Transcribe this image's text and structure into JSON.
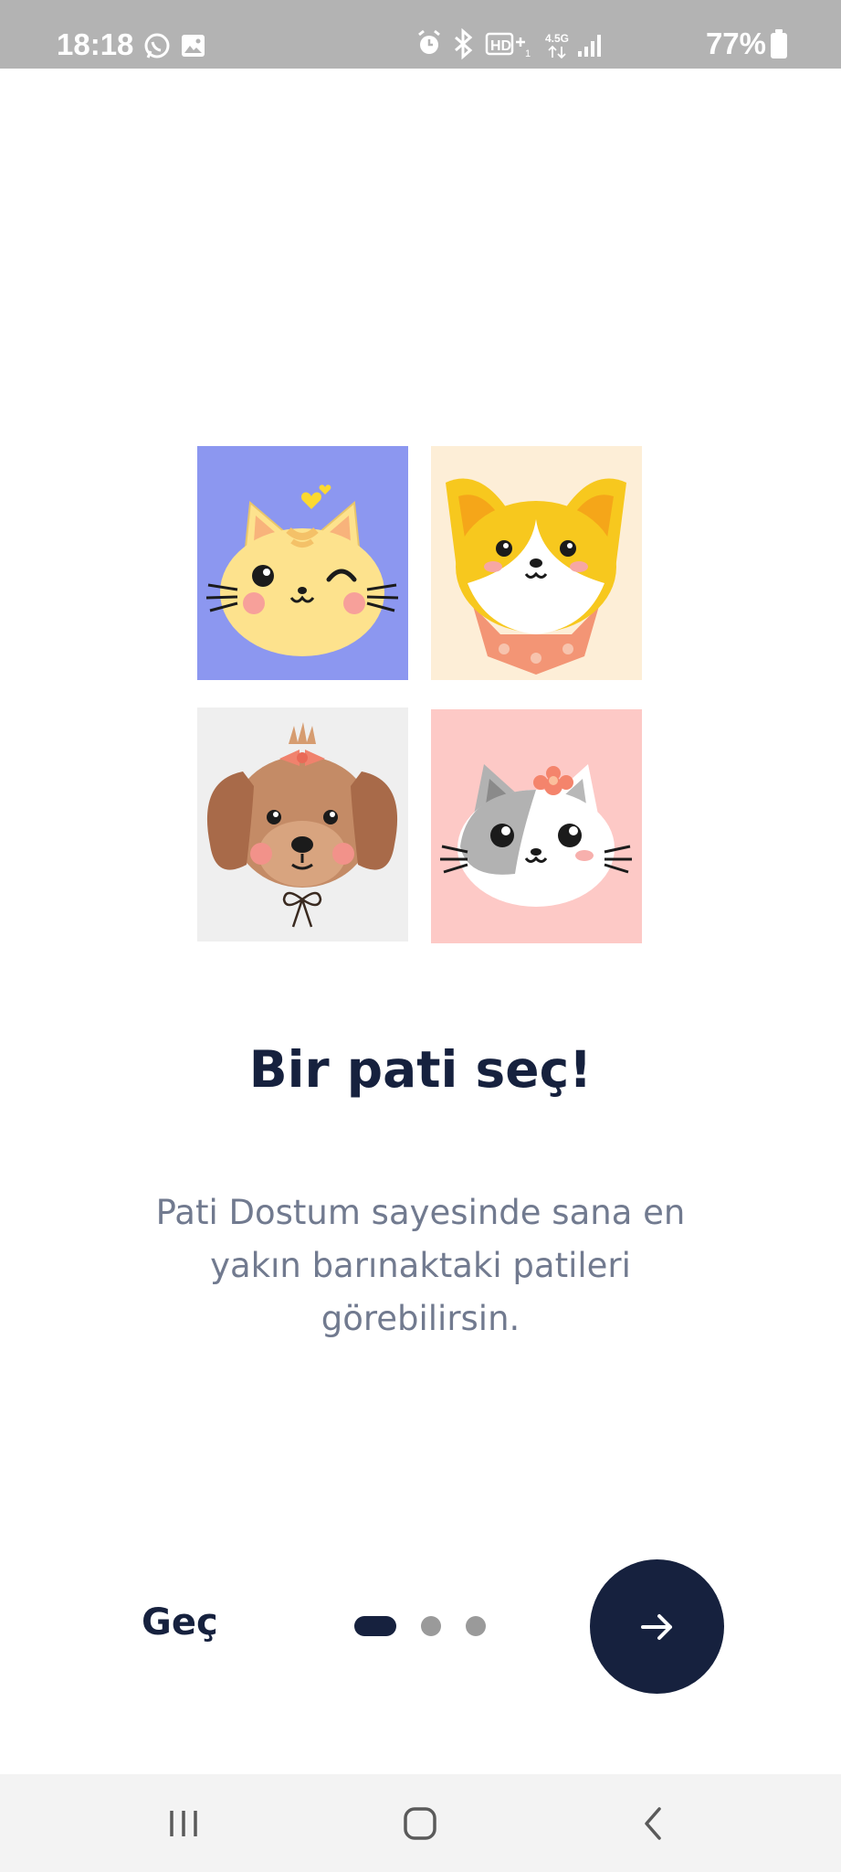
{
  "status_bar": {
    "time": "18:18",
    "battery": "77%",
    "icons": [
      "whatsapp-icon",
      "gallery-icon",
      "alarm-icon",
      "bluetooth-icon",
      "hd-plus-icon",
      "4-5g-icon",
      "signal-icon",
      "battery-icon"
    ]
  },
  "illustration": {
    "tiles": [
      {
        "animal": "yellow-cat",
        "background": "#8c97f0"
      },
      {
        "animal": "corgi-dog",
        "background": "#fdeed7"
      },
      {
        "animal": "brown-puppy",
        "background": "#efefef"
      },
      {
        "animal": "grey-white-cat",
        "background": "#fdc9c6"
      }
    ]
  },
  "onboarding": {
    "title": "Bir pati seç!",
    "description": "Pati Dostum sayesinde sana en yakın barınaktaki patileri görebilirsin.",
    "skip_label": "Geç",
    "page_count": 3,
    "current_page": 1
  },
  "colors": {
    "primary": "#16213e",
    "text_secondary": "#717a8f",
    "dot_inactive": "#9a9a9a"
  },
  "nav_bar": {
    "buttons": [
      "recents-icon",
      "home-icon",
      "back-icon"
    ]
  }
}
